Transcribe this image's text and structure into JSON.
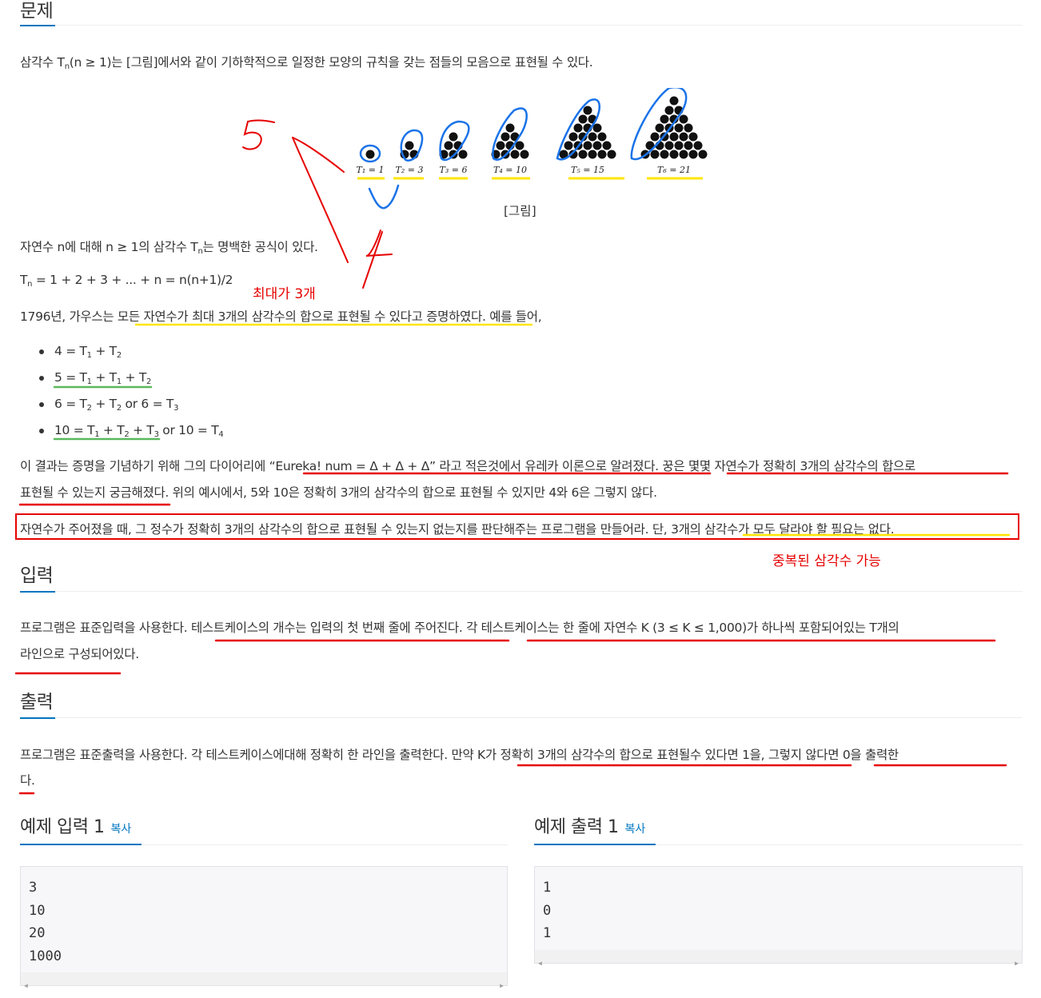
{
  "sections": {
    "problem": "문제",
    "input": "입력",
    "output": "출력"
  },
  "problem": {
    "intro_pre": "삼각수 T",
    "intro_sub": "n",
    "intro_post": "(n ≥ 1)는 [그림]에서와 같이 기하학적으로 일정한 모양의 규칙을 갖는 점들의 모음으로 표현될 수 있다.",
    "figure_caption": "[그림]",
    "figure_labels": [
      "T₁ = 1",
      "T₂ = 3",
      "T₃ = 6",
      "T₄ = 10",
      "T₅ = 15",
      "T₆ = 21"
    ],
    "formula_intro_pre": "자연수 n에 대해 n ≥ 1의 삼각수 T",
    "formula_intro_sub": "n",
    "formula_intro_post": "는 명백한 공식이 있다.",
    "formula_T": "T",
    "formula_sub": "n",
    "formula_rest": " = 1 + 2 + 3 + ... + n = n(n+1)/2",
    "gauss": "1796년, 가우스는 모든 자연수가 최대 3개의 삼각수의 합으로 표현될 수 있다고 증명하였다. 예를 들어,",
    "examples": [
      {
        "a": "4 = T",
        "as": "1",
        "b": " + T",
        "bs": "2"
      },
      {
        "a": "5 = T",
        "as": "1",
        "b": " + T",
        "bs": "1",
        "c": " + T",
        "cs": "2"
      },
      {
        "a": "6 = T",
        "as": "2",
        "b": " + T",
        "bs": "2",
        "c": " or 6 = T",
        "cs": "3"
      },
      {
        "a": "10 = T",
        "as": "1",
        "b": " + T",
        "bs": "2",
        "c": " + T",
        "cs": "3",
        "d": " or 10 = T",
        "ds": "4"
      }
    ],
    "eureka_line1": "이 결과는 증명을 기념하기 위해 그의 다이어리에 “Eureka! num = Δ + Δ + Δ” 라고 적은것에서 유레카 이론으로 알려졌다. 꿍은 몇몇 자연수가 정확히 3개의 삼각수의 합으로",
    "eureka_line2": "표현될 수 있는지 궁금해졌다. 위의 예시에서, 5와 10은 정확히 3개의 삼각수의 합으로 표현될 수 있지만 4와 6은 그렇지 않다.",
    "task": "자연수가 주어졌을 때, 그 정수가 정확히 3개의 삼각수의 합으로 표현될 수 있는지 없는지를 판단해주는 프로그램을 만들어라. 단, 3개의 삼각수가 모두 달라야 할 필요는 없다."
  },
  "input": {
    "line1": "프로그램은 표준입력을 사용한다. 테스트케이스의 개수는 입력의 첫 번째 줄에 주어진다. 각 테스트케이스는 한 줄에 자연수 K (3 ≤ K ≤ 1,000)가 하나씩 포함되어있는 T개의",
    "line2": "라인으로 구성되어있다."
  },
  "output": {
    "line1": "프로그램은 표준출력을 사용한다. 각 테스트케이스에대해 정확히 한 라인을 출력한다. 만약 K가 정확히 3개의 삼각수의 합으로 표현될수 있다면 1을, 그렇지 않다면 0을 출력한",
    "line2": "다."
  },
  "samples": {
    "input_title": "예제 입력 1",
    "output_title": "예제 출력 1",
    "copy_label": "복사",
    "input_lines": [
      "3",
      "10",
      "20",
      "1000"
    ],
    "output_lines": [
      "1",
      "0",
      "1"
    ]
  },
  "annotations": {
    "max_three": "최대가 3개",
    "duplicates_ok": "중복된 삼각수 가능",
    "handwritten_5": "5",
    "handwritten_4": "4"
  },
  "colors": {
    "accent": "#0076c0",
    "annotation_red": "#e60000",
    "highlight_yellow": "#ffe600",
    "highlight_green": "#5cb85c",
    "pen_blue": "#1a73e8"
  }
}
